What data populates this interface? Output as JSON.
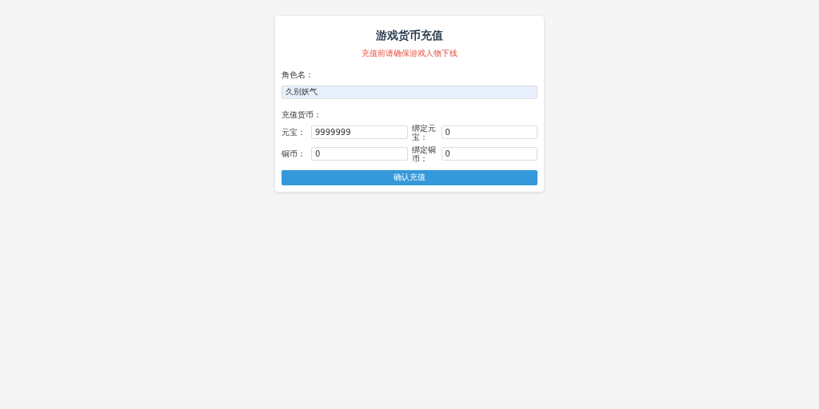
{
  "title": "游戏货币充值",
  "notice": "充值前请确保游戏人物下线",
  "role_field": {
    "label": "角色名：",
    "value": "久别妖气",
    "autofilled": true
  },
  "currency_section": {
    "label": "充值货币：",
    "fields": [
      {
        "label": "元宝：",
        "value": "9999999"
      },
      {
        "label": "绑定元宝：",
        "value": "0"
      },
      {
        "label": "铜币：",
        "value": "0"
      },
      {
        "label": "绑定铜币：",
        "value": "0"
      }
    ]
  },
  "submit_button": "确认充值"
}
